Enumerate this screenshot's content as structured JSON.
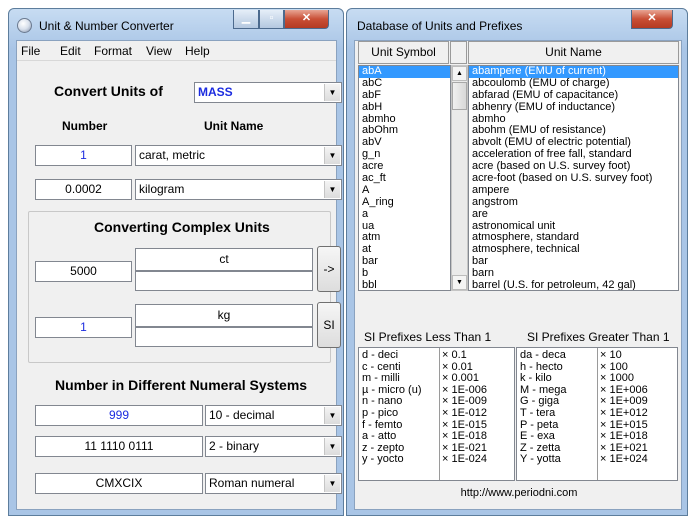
{
  "left_window": {
    "title": "Unit & Number Converter",
    "menu": [
      "File",
      "Edit",
      "Format",
      "View",
      "Help"
    ],
    "convert": {
      "heading": "Convert Units of",
      "category": "MASS",
      "col_number": "Number",
      "col_unit": "Unit Name",
      "row1_number": "1",
      "row1_unit": "carat, metric",
      "row2_number": "0.0002",
      "row2_unit": "kilogram"
    },
    "complex": {
      "heading": "Converting Complex Units",
      "number1": "5000",
      "unit1": "ct",
      "unit1b": "",
      "arrow_btn": "->",
      "number2": "1",
      "unit2": "kg",
      "unit2b": "",
      "si_btn": "SI"
    },
    "numeral": {
      "heading": "Number in Different Numeral Systems",
      "row1_value": "999",
      "row1_system": "10 - decimal",
      "row2_value": "11 1110 0111",
      "row2_system": "2 - binary",
      "row3_value": "CMXCIX",
      "row3_system": "Roman numeral"
    }
  },
  "right_window": {
    "title": "Database of Units and Prefixes",
    "col_symbol": "Unit Symbol",
    "col_name": "Unit Name",
    "symbols": [
      "abA",
      "abC",
      "abF",
      "abH",
      "abmho",
      "abOhm",
      "abV",
      "g_n",
      "acre",
      "ac_ft",
      "A",
      "A_ring",
      "a",
      "ua",
      "atm",
      "at",
      "bar",
      "b",
      "bbl"
    ],
    "names": [
      "abampere (EMU of current)",
      "abcoulomb (EMU of charge)",
      "abfarad (EMU of capacitance)",
      "abhenry (EMU of inductance)",
      "abmho",
      "abohm (EMU of resistance)",
      "abvolt (EMU of electric potential)",
      "acceleration of free fall, standard",
      "acre (based on U.S. survey foot)",
      "acre-foot (based on U.S. survey foot)",
      "ampere",
      "angstrom",
      "are",
      "astronomical unit",
      "atmosphere, standard",
      "atmosphere, technical",
      "bar",
      "barn",
      "barrel (U.S. for petroleum, 42 gal)"
    ],
    "prefix_less_title": "SI Prefixes Less Than 1",
    "prefix_greater_title": "SI Prefixes Greater Than 1",
    "less_names": [
      "d - deci",
      "c - centi",
      "m - milli",
      "µ - micro (u)",
      "n - nano",
      "p - pico",
      "f - femto",
      "a - atto",
      "z - zepto",
      "y - yocto"
    ],
    "less_values": [
      "× 0.1",
      "× 0.01",
      "× 0.001",
      "× 1E-006",
      "× 1E-009",
      "× 1E-012",
      "× 1E-015",
      "× 1E-018",
      "× 1E-021",
      "× 1E-024"
    ],
    "greater_names": [
      "da - deca",
      "h - hecto",
      "k - kilo",
      "M - mega",
      "G - giga",
      "T - tera",
      "P - peta",
      "E - exa",
      "Z - zetta",
      "Y - yotta"
    ],
    "greater_values": [
      "× 10",
      "× 100",
      "× 1000",
      "× 1E+006",
      "× 1E+009",
      "× 1E+012",
      "× 1E+015",
      "× 1E+018",
      "× 1E+021",
      "× 1E+024"
    ],
    "url": "http://www.periodni.com"
  },
  "icons": [
    "app-icon",
    "minimize-icon",
    "maximize-icon",
    "close-icon",
    "chevron-down-icon",
    "scroll-up-icon",
    "scroll-down-icon"
  ]
}
